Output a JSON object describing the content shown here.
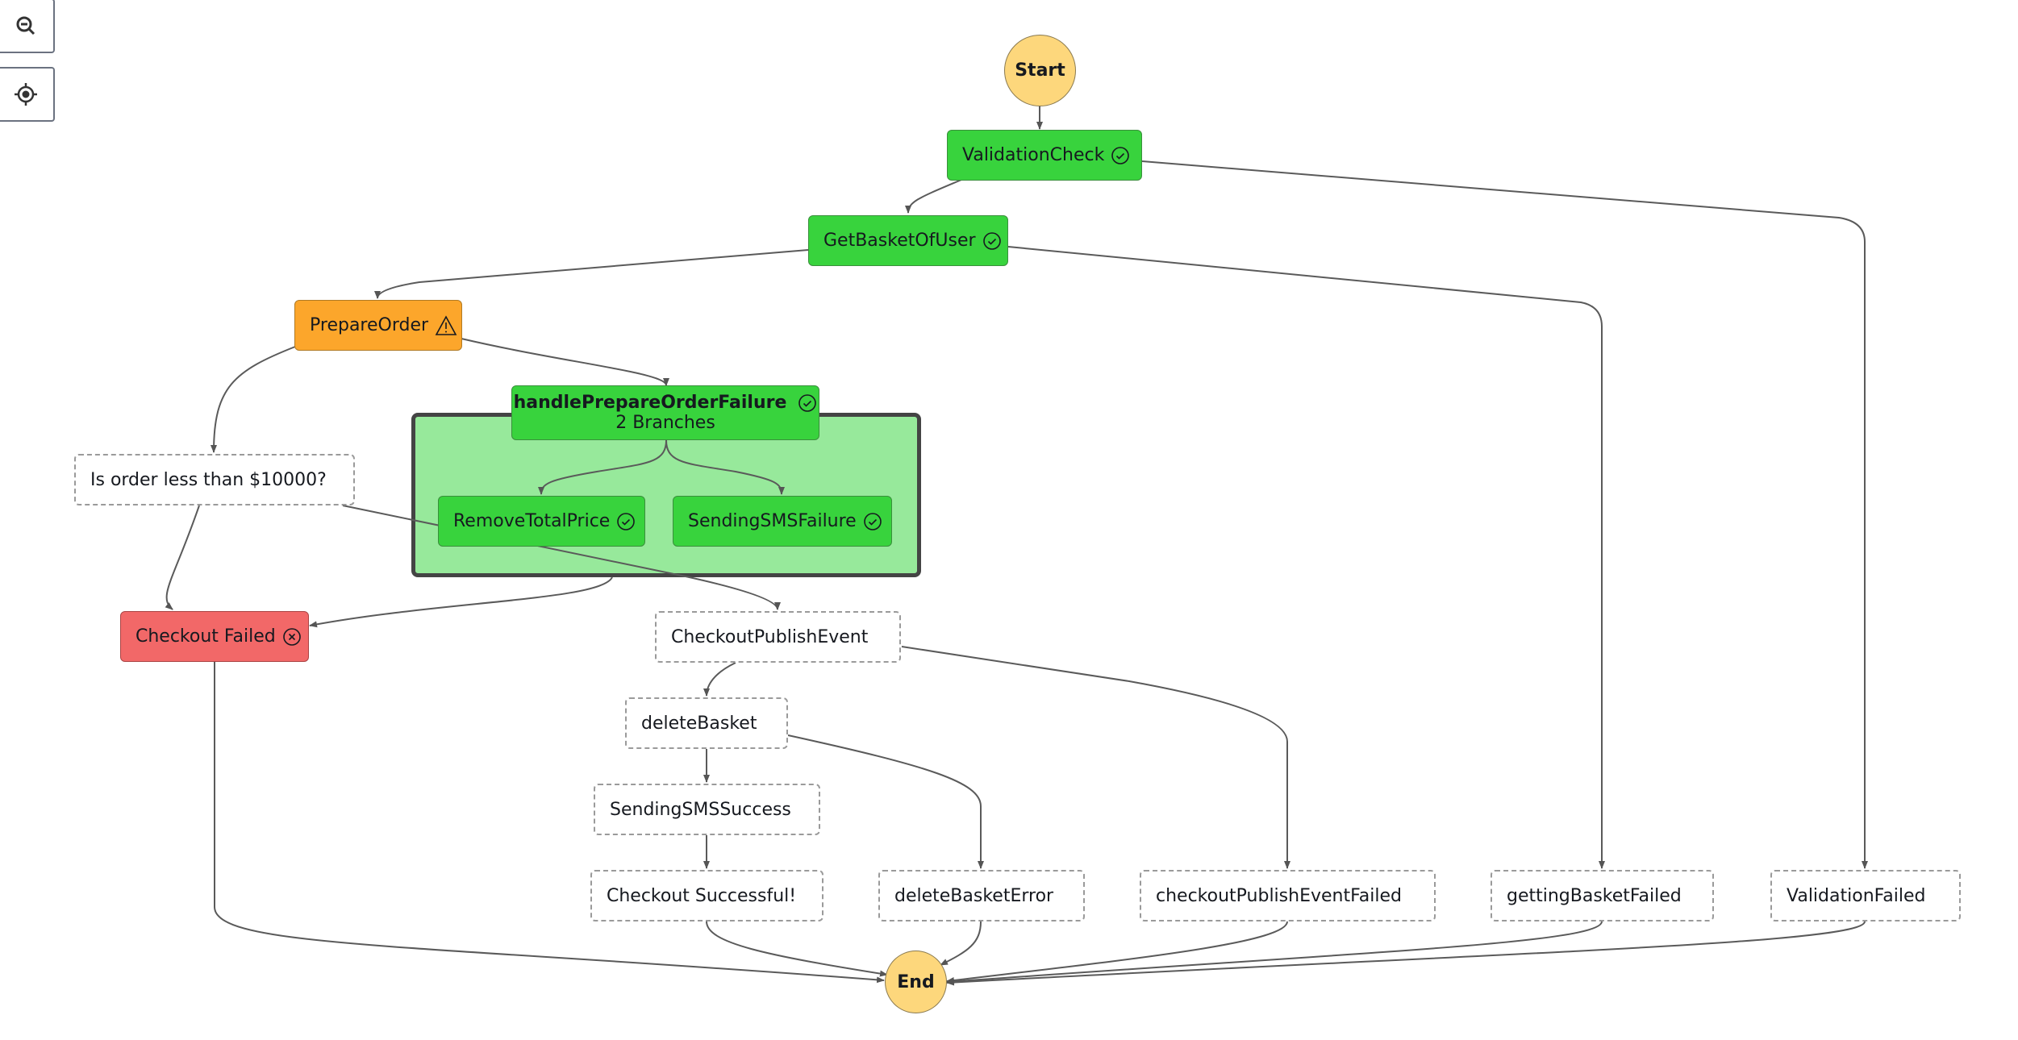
{
  "controls": {
    "zoom_out": "zoom-out-icon",
    "center": "center-icon"
  },
  "colors": {
    "succeeded": "#38d33d",
    "caught_error": "#fca62b",
    "failed": "#f26868",
    "not_executed": "#ffffff",
    "terminal": "#fdd77c",
    "parallel_bg": "#97e99b"
  },
  "start": "Start",
  "end": "End",
  "nodes": {
    "validation_check": {
      "label": "ValidationCheck",
      "status": "succeeded"
    },
    "get_basket": {
      "label": "GetBasketOfUser",
      "status": "succeeded"
    },
    "prepare_order": {
      "label": "PrepareOrder",
      "status": "caught-error"
    },
    "handle_failure": {
      "label": "handlePrepareOrderFailure",
      "sublabel": "2 Branches",
      "status": "succeeded"
    },
    "remove_total": {
      "label": "RemoveTotalPrice",
      "status": "succeeded"
    },
    "sms_failure": {
      "label": "SendingSMSFailure",
      "status": "succeeded"
    },
    "is_order": {
      "label": "Is order less than $10000?",
      "status": "not-executed"
    },
    "checkout_failed": {
      "label": "Checkout Failed",
      "status": "failed"
    },
    "publish_event": {
      "label": "CheckoutPublishEvent",
      "status": "not-executed"
    },
    "delete_basket": {
      "label": "deleteBasket",
      "status": "not-executed"
    },
    "sms_success": {
      "label": "SendingSMSSuccess",
      "status": "not-executed"
    },
    "checkout_success": {
      "label": "Checkout Successful!",
      "status": "not-executed"
    },
    "delete_basket_error": {
      "label": "deleteBasketError",
      "status": "not-executed"
    },
    "publish_failed": {
      "label": "checkoutPublishEventFailed",
      "status": "not-executed"
    },
    "getting_basket_failed": {
      "label": "gettingBasketFailed",
      "status": "not-executed"
    },
    "validation_failed": {
      "label": "ValidationFailed",
      "status": "not-executed"
    }
  }
}
